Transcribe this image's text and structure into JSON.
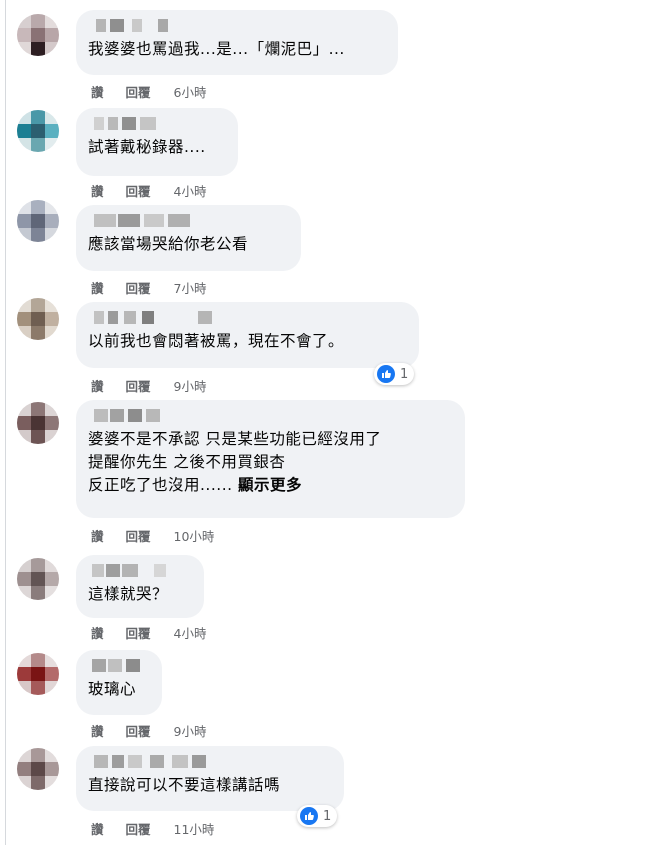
{
  "actions": {
    "like": "讚",
    "reply": "回覆"
  },
  "comments": [
    {
      "text": "我婆婆也罵過我...是...「爛泥巴」...",
      "time": "6小時"
    },
    {
      "text": "試著戴秘錄器....",
      "time": "4小時"
    },
    {
      "text": "應該當場哭給你老公看",
      "time": "7小時"
    },
    {
      "text": "以前我也會悶著被罵，現在不會了。",
      "time": "9小時",
      "reaction_count": "1"
    },
    {
      "text": "婆婆不是不承認 只是某些功能已經沒用了\n提醒你先生 之後不用買銀杏\n反正吃了也沒用......",
      "more": "顯示更多",
      "time": "10小時"
    },
    {
      "text": "這樣就哭？",
      "time": "4小時"
    },
    {
      "text": "玻璃心",
      "time": "9小時"
    },
    {
      "text": "直接說可以不要這樣講話嗎",
      "time": "11小時",
      "reaction_count": "1"
    }
  ],
  "colors": {
    "bubble": "#f0f2f5",
    "meta": "#65676b",
    "like": "#1877f2",
    "text": "#050505"
  }
}
